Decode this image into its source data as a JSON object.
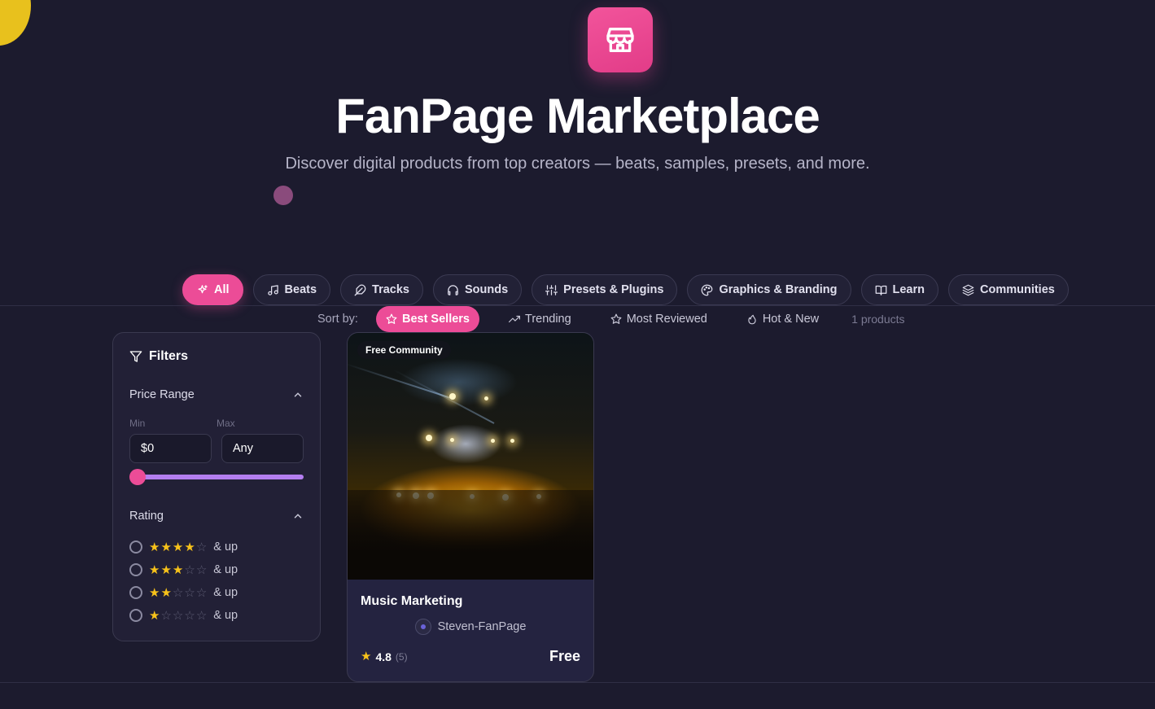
{
  "hero": {
    "icon": "storefront-icon",
    "title": "FanPage Marketplace",
    "subtitle": "Discover digital products from top creators — beats, samples, presets, and more."
  },
  "categories": [
    {
      "label": "All",
      "icon": "sparkles-icon",
      "active": true
    },
    {
      "label": "Beats",
      "icon": "music-note-icon",
      "active": false
    },
    {
      "label": "Tracks",
      "icon": "feather-icon",
      "active": false
    },
    {
      "label": "Sounds",
      "icon": "headphones-icon",
      "active": false
    },
    {
      "label": "Presets & Plugins",
      "icon": "sliders-icon",
      "active": false
    },
    {
      "label": "Graphics & Branding",
      "icon": "palette-icon",
      "active": false
    },
    {
      "label": "Learn",
      "icon": "book-icon",
      "active": false
    },
    {
      "label": "Communities",
      "icon": "layers-icon",
      "active": false
    }
  ],
  "sort": {
    "label": "Sort by:",
    "options": [
      {
        "label": "Best Sellers",
        "icon": "star-icon",
        "active": true
      },
      {
        "label": "Trending",
        "icon": "trending-up-icon",
        "active": false
      },
      {
        "label": "Most Reviewed",
        "icon": "star-outline-icon",
        "active": false
      },
      {
        "label": "Hot & New",
        "icon": "flame-icon",
        "active": false
      }
    ],
    "count": "1 products"
  },
  "filters": {
    "title": "Filters",
    "price_range": {
      "label": "Price Range",
      "min_label": "Min",
      "max_label": "Max",
      "min_value": "$0",
      "max_value": "Any"
    },
    "rating": {
      "label": "Rating",
      "suffix": "& up",
      "options": [
        4,
        3,
        2,
        1
      ]
    }
  },
  "products": [
    {
      "badge": "Free Community",
      "title": "Music Marketing",
      "creator": "Steven-FanPage",
      "rating": "4.8",
      "reviews": "(5)",
      "price": "Free"
    }
  ],
  "colors": {
    "background": "#1c1b2e",
    "accent": "#ec4c97",
    "slider": "#b47ef0",
    "star": "#f7c21a"
  }
}
